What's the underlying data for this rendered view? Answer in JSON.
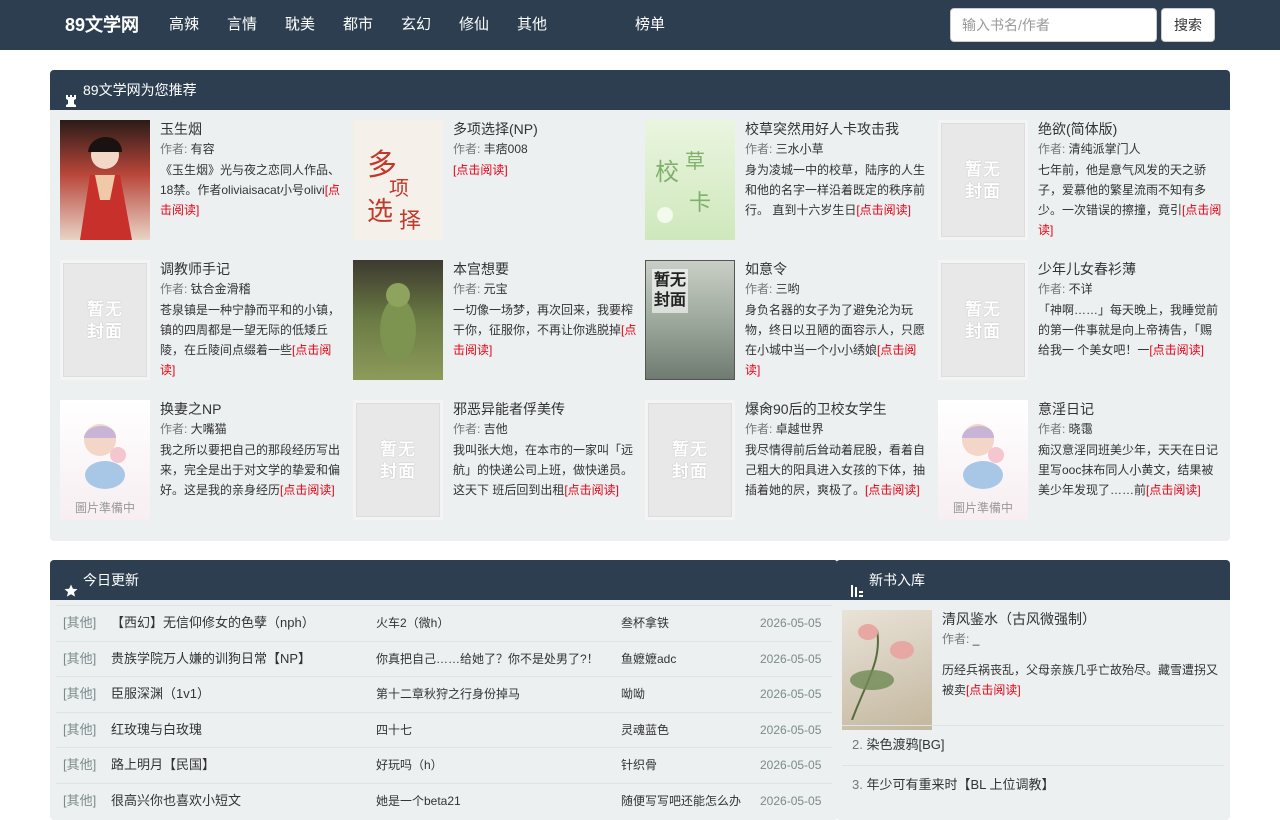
{
  "navbar": {
    "brand": "89文学网",
    "items": [
      "高辣",
      "言情",
      "耽美",
      "都市",
      "玄幻",
      "修仙",
      "其他",
      "榜单"
    ],
    "search_placeholder": "输入书名/作者",
    "search_button": "搜索"
  },
  "recommend": {
    "title": "89文学网为您推荐",
    "author_prefix": "作者:",
    "more_label": "[点击阅读]",
    "books": [
      {
        "title": "玉生烟",
        "author": "有容",
        "desc": "《玉生烟》光与夜之恋同人作品、18禁。作者oliviaisacat小号olivi",
        "cover": "img",
        "cover_color": "#b8463a"
      },
      {
        "title": "多项选择(NP)",
        "author": "丰痞008",
        "desc": "",
        "cover": "img",
        "cover_color": "#f2ece6"
      },
      {
        "title": "校草突然用好人卡攻击我",
        "author": "三水小草",
        "desc": "身为凌城一中的校草，陆序的人生和他的名字一样沿着既定的秩序前行。 直到十六岁生日",
        "cover": "img",
        "cover_color": "#dfeecf"
      },
      {
        "title": "绝欲(简体版)",
        "author": "清纯派掌门人",
        "desc": "七年前，他是意气风发的天之骄子，爱慕他的繁星流雨不知有多少。一次错误的擦撞，竟引",
        "cover": "placeholder"
      },
      {
        "title": "调教师手记",
        "author": "钛合金滑稽",
        "desc": "苍泉镇是一种宁静而平和的小镇，镇的四周都是一望无际的低矮丘陵，在丘陵间点缀着一些",
        "cover": "placeholder"
      },
      {
        "title": "本宫想要",
        "author": "元宝",
        "desc": "一切像一场梦，再次回来，我要榨干你，征服你，不再让你逃脱掉",
        "cover": "img",
        "cover_color": "#5d6a3f"
      },
      {
        "title": "如意令",
        "author": "三哟",
        "desc": "身负名器的女子为了避免沦为玩物，终日以丑陋的面容示人，只愿在小城中当一个小小绣娘",
        "cover": "img",
        "cover_color": "#8f9a8e"
      },
      {
        "title": "少年儿女春衫薄",
        "author": "不详",
        "desc": "「神啊……」每天晚上，我睡觉前的第一件事就是向上帝祷告，「赐给我一 个美女吧！一",
        "cover": "placeholder"
      },
      {
        "title": "换妻之NP",
        "author": "大嘴猫",
        "desc": "我之所以要把自己的那段经历写出来，完全是出于对文学的挚爱和偏好。这是我的亲身经历",
        "cover": "img",
        "cover_color": "#f6eef0"
      },
      {
        "title": "邪恶异能者俘美传",
        "author": "吉他",
        "desc": "我叫张大炮，在本市的一家叫「远航」的快递公司上班，做快递员。这天下 班后回到出租",
        "cover": "placeholder"
      },
      {
        "title": "爆肏90后的卫校女学生",
        "author": "卓越世界",
        "desc": "我尽情得前后耸动着屁股，看着自己粗大的阳具进入女孩的下体，抽插着她的屄，爽极了。",
        "cover": "placeholder"
      },
      {
        "title": "意淫日记",
        "author": "晓霭",
        "desc": "痴汉意淫同班美少年，天天在日记里写ooc抹布同人小黄文，结果被美少年发现了……前",
        "cover": "img",
        "cover_color": "#f6eef0"
      }
    ],
    "placeholder_line1": "暂无",
    "placeholder_line2": "封面",
    "wait_text": "圖片準備中",
    "cover6_line1": "暂无",
    "cover6_line2": "封面"
  },
  "today": {
    "title": "今日更新",
    "rows": [
      {
        "cat": "[其他]",
        "title": "【西幻】无信仰修女的色孽（nph）",
        "chapter": "火车2（微h）",
        "author": "叁杯拿铁",
        "date": "2026-05-05"
      },
      {
        "cat": "[其他]",
        "title": "贵族学院万人嫌的训狗日常【NP】",
        "chapter": "你真把自己……给她了？你不是处男了?！",
        "author": "鱼嬷嬷adc",
        "date": "2026-05-05"
      },
      {
        "cat": "[其他]",
        "title": "臣服深渊（1v1）",
        "chapter": "第十二章秋狩之行身份掉马",
        "author": "呦呦",
        "date": "2026-05-05"
      },
      {
        "cat": "[其他]",
        "title": "红玫瑰与白玫瑰",
        "chapter": "四十七",
        "author": "灵魂蓝色",
        "date": "2026-05-05"
      },
      {
        "cat": "[其他]",
        "title": "路上明月【民国】",
        "chapter": "好玩吗（h）",
        "author": "针织骨",
        "date": "2026-05-05"
      },
      {
        "cat": "[其他]",
        "title": "很高兴你也喜欢小短文",
        "chapter": "她是一个beta21",
        "author": "随便写写吧还能怎么办",
        "date": "2026-05-05"
      }
    ]
  },
  "newbooks": {
    "title": "新书入库",
    "top": {
      "title": "清风鉴水（古风微强制）",
      "author_prefix": "作者:",
      "author": "_",
      "desc": "历经兵祸丧乱，父母亲族几乎亡故殆尽。藏雪遭拐又被卖",
      "more": "[点击阅读]"
    },
    "list": [
      {
        "num": "2.",
        "title": "染色渡鸦[BG]"
      },
      {
        "num": "3.",
        "title": "年少可有重来时【BL 上位调教】"
      }
    ]
  }
}
